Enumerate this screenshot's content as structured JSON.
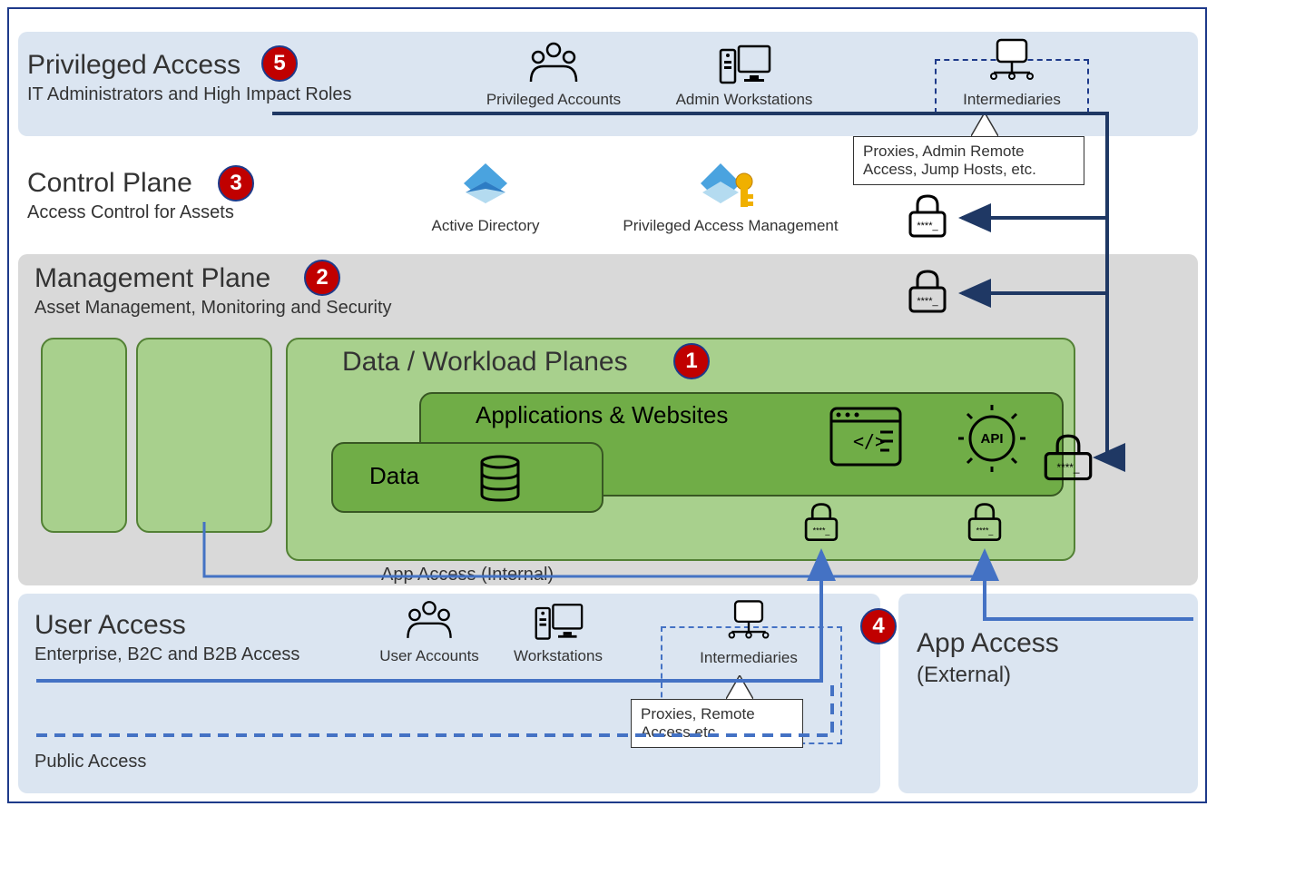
{
  "diagram": {
    "privileged_access": {
      "title": "Privileged Access",
      "subtitle": "IT Administrators and High Impact Roles",
      "badge": "5",
      "items": {
        "privileged_accounts": "Privileged Accounts",
        "admin_workstations": "Admin Workstations",
        "intermediaries": "Intermediaries",
        "tooltip": "Proxies, Admin Remote Access, Jump Hosts, etc."
      }
    },
    "control_plane": {
      "title": "Control Plane",
      "subtitle": "Access Control for Assets",
      "badge": "3",
      "items": {
        "active_directory": "Active Directory",
        "pam": "Privileged Access Management"
      }
    },
    "management_plane": {
      "title": "Management Plane",
      "subtitle": "Asset Management, Monitoring and Security",
      "badge": "2"
    },
    "data_workload": {
      "title": "Data / Workload Planes",
      "badge": "1",
      "apps_title": "Applications & Websites",
      "data_title": "Data"
    },
    "app_access_internal": "App Access (Internal)",
    "user_access": {
      "title": "User Access",
      "subtitle": "Enterprise, B2C and B2B Access",
      "badge": "4",
      "public": "Public Access",
      "items": {
        "user_accounts": "User Accounts",
        "workstations": "Workstations",
        "intermediaries": "Intermediaries",
        "tooltip": "Proxies, Remote Access etc."
      }
    },
    "app_access_external": {
      "title": "App Access",
      "subtitle": "(External)"
    }
  }
}
